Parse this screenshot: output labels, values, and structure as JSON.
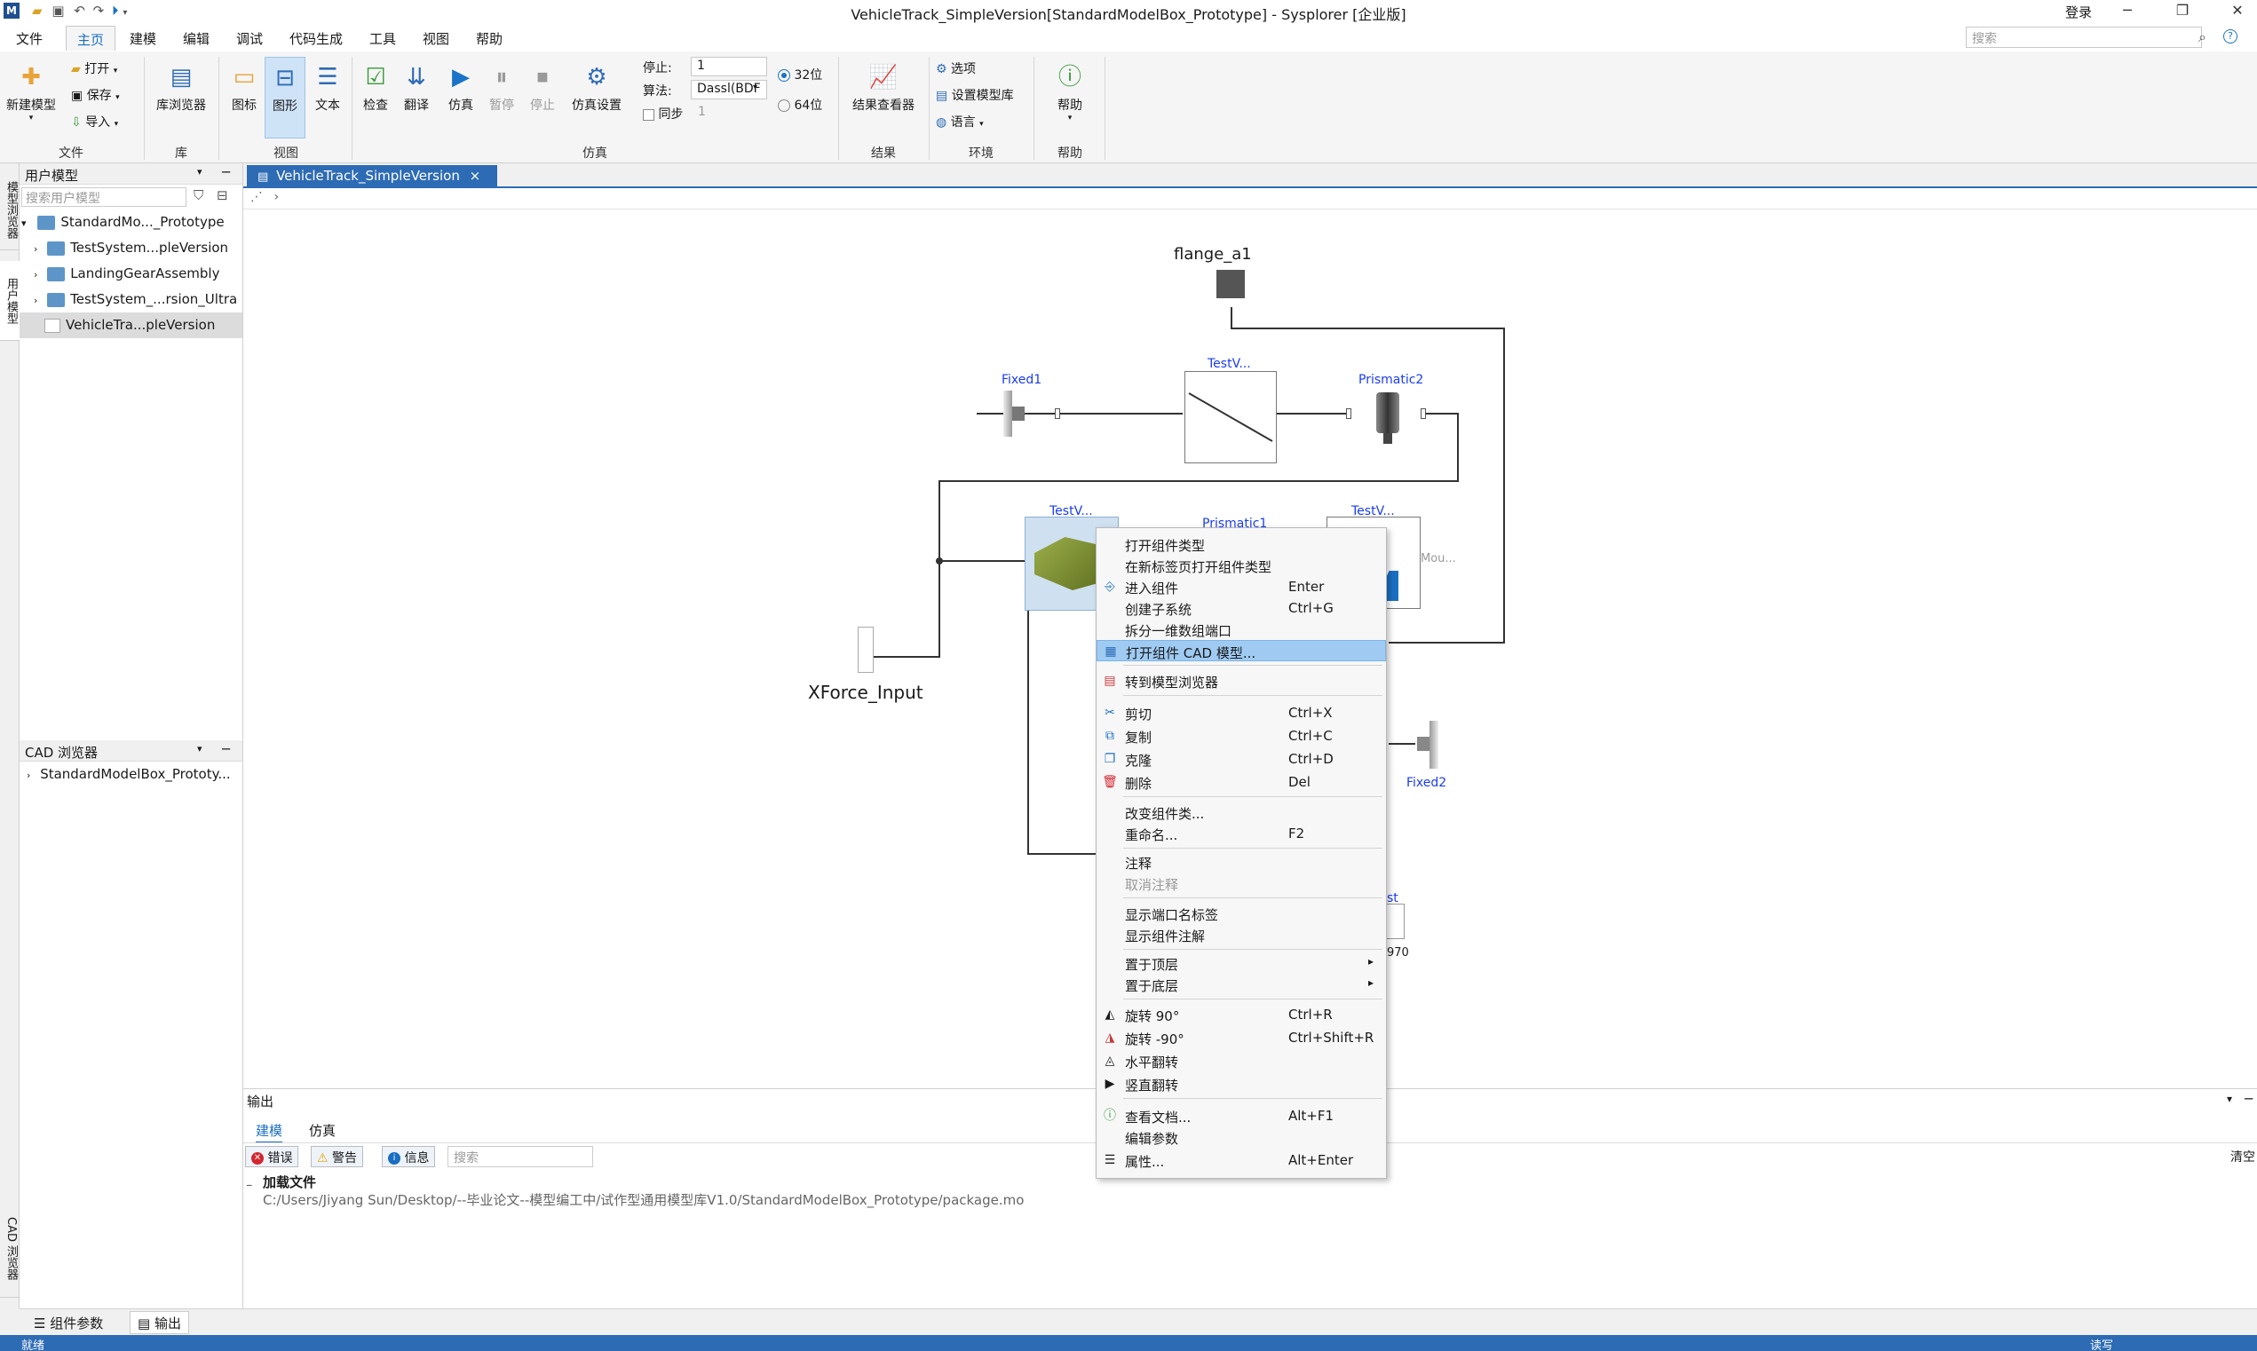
{
  "app": {
    "title": "VehicleTrack_SimpleVersion[StandardModelBox_Prototype] - Sysplorer [企业版]",
    "login": "登录",
    "logo": "M"
  },
  "menubar": {
    "items": [
      "文件",
      "主页",
      "建模",
      "编辑",
      "调试",
      "代码生成",
      "工具",
      "视图",
      "帮助"
    ],
    "search_placeholder": "搜索"
  },
  "ribbon": {
    "file": {
      "new_model": "新建模型",
      "open": "打开",
      "save": "保存",
      "import": "导入",
      "group": "文件"
    },
    "lib": {
      "browser": "库浏览器",
      "group": "库"
    },
    "view": {
      "icon": "图标",
      "diagram": "图形",
      "text": "文本",
      "group": "视图"
    },
    "sim": {
      "check": "检查",
      "translate": "翻译",
      "simulate": "仿真",
      "pause": "暂停",
      "stop": "停止",
      "settings": "仿真设置",
      "stop_time_label": "停止:",
      "stop_time_value": "1",
      "algo_label": "算法:",
      "algo_value": "Dassl(BDF",
      "sync_label": "同步",
      "sync_value": "1",
      "bit32": "32位",
      "bit64": "64位",
      "group": "仿真"
    },
    "result": {
      "viewer": "结果查看器",
      "group": "结果"
    },
    "env": {
      "options": "选项",
      "set_lib": "设置模型库",
      "language": "语言",
      "group": "环境"
    },
    "help": {
      "help": "帮助",
      "group": "帮助"
    }
  },
  "left": {
    "vtabs": [
      "模型浏览器",
      "用户模型",
      "CAD 浏览器"
    ],
    "user_models_title": "用户模型",
    "search_placeholder": "搜索用户模型",
    "tree": [
      {
        "label": "StandardMo..._Prototype",
        "level": 0,
        "expanded": true
      },
      {
        "label": "TestSystem...pleVersion",
        "level": 1
      },
      {
        "label": "LandingGearAssembly",
        "level": 1
      },
      {
        "label": "TestSystem_...rsion_Ultra",
        "level": 1
      },
      {
        "label": "VehicleTra...pleVersion",
        "level": 1,
        "selected": true
      }
    ],
    "cad_title": "CAD 浏览器",
    "cad_tree": [
      "StandardModelBox_Prototy..."
    ]
  },
  "doc": {
    "tab": "VehicleTrack_SimpleVersion",
    "close": "×"
  },
  "diagram": {
    "flange": "flange_a1",
    "fixed1": "Fixed1",
    "testv_top": "TestV...",
    "prismatic2": "Prismatic2",
    "testv_left": "TestV...",
    "prismatic1": "Prismatic1",
    "testv_right": "TestV...",
    "mou": "Mou...",
    "xforce": "XForce_Input",
    "fixed2": "Fixed2",
    "partial_label": "st",
    "partial_value": "970"
  },
  "output": {
    "title": "输出",
    "tabs": [
      "建模",
      "仿真"
    ],
    "filters": {
      "error": "错误",
      "warning": "警告",
      "info": "信息"
    },
    "search_placeholder": "搜索",
    "clear": "清空",
    "log_title": "加载文件",
    "log_path": "C:/Users/Jiyang Sun/Desktop/--毕业论文--模型编工中/试作型通用模型库V1.0/StandardModelBox_Prototype/package.mo"
  },
  "bottom_tabs": [
    "组件参数",
    "输出"
  ],
  "status": {
    "left": "就绪",
    "right": "读写"
  },
  "context_menu": {
    "items": [
      {
        "label": "打开组件类型",
        "shortcut": ""
      },
      {
        "label": "在新标签页打开组件类型",
        "shortcut": ""
      },
      {
        "label": "进入组件",
        "shortcut": "Enter"
      },
      {
        "label": "创建子系统",
        "shortcut": "Ctrl+G"
      },
      {
        "label": "拆分一维数组端口",
        "shortcut": ""
      },
      {
        "label": "打开组件 CAD 模型...",
        "shortcut": ""
      },
      {
        "label": "转到模型浏览器",
        "shortcut": ""
      },
      {
        "label": "剪切",
        "shortcut": "Ctrl+X"
      },
      {
        "label": "复制",
        "shortcut": "Ctrl+C"
      },
      {
        "label": "克隆",
        "shortcut": "Ctrl+D"
      },
      {
        "label": "删除",
        "shortcut": "Del"
      },
      {
        "label": "改变组件类...",
        "shortcut": ""
      },
      {
        "label": "重命名...",
        "shortcut": "F2"
      },
      {
        "label": "注释",
        "shortcut": ""
      },
      {
        "label": "取消注释",
        "shortcut": ""
      },
      {
        "label": "显示端口名标签",
        "shortcut": ""
      },
      {
        "label": "显示组件注解",
        "shortcut": ""
      },
      {
        "label": "置于顶层",
        "shortcut": ""
      },
      {
        "label": "置于底层",
        "shortcut": ""
      },
      {
        "label": "旋转 90°",
        "shortcut": "Ctrl+R"
      },
      {
        "label": "旋转 -90°",
        "shortcut": "Ctrl+Shift+R"
      },
      {
        "label": "水平翻转",
        "shortcut": ""
      },
      {
        "label": "竖直翻转",
        "shortcut": ""
      },
      {
        "label": "查看文档...",
        "shortcut": "Alt+F1"
      },
      {
        "label": "编辑参数",
        "shortcut": ""
      },
      {
        "label": "属性...",
        "shortcut": "Alt+Enter"
      }
    ]
  },
  "colors": {
    "accent": "#2d6bb5",
    "highlight": "#9fcbf3",
    "diagram_label": "#1a3df0"
  }
}
